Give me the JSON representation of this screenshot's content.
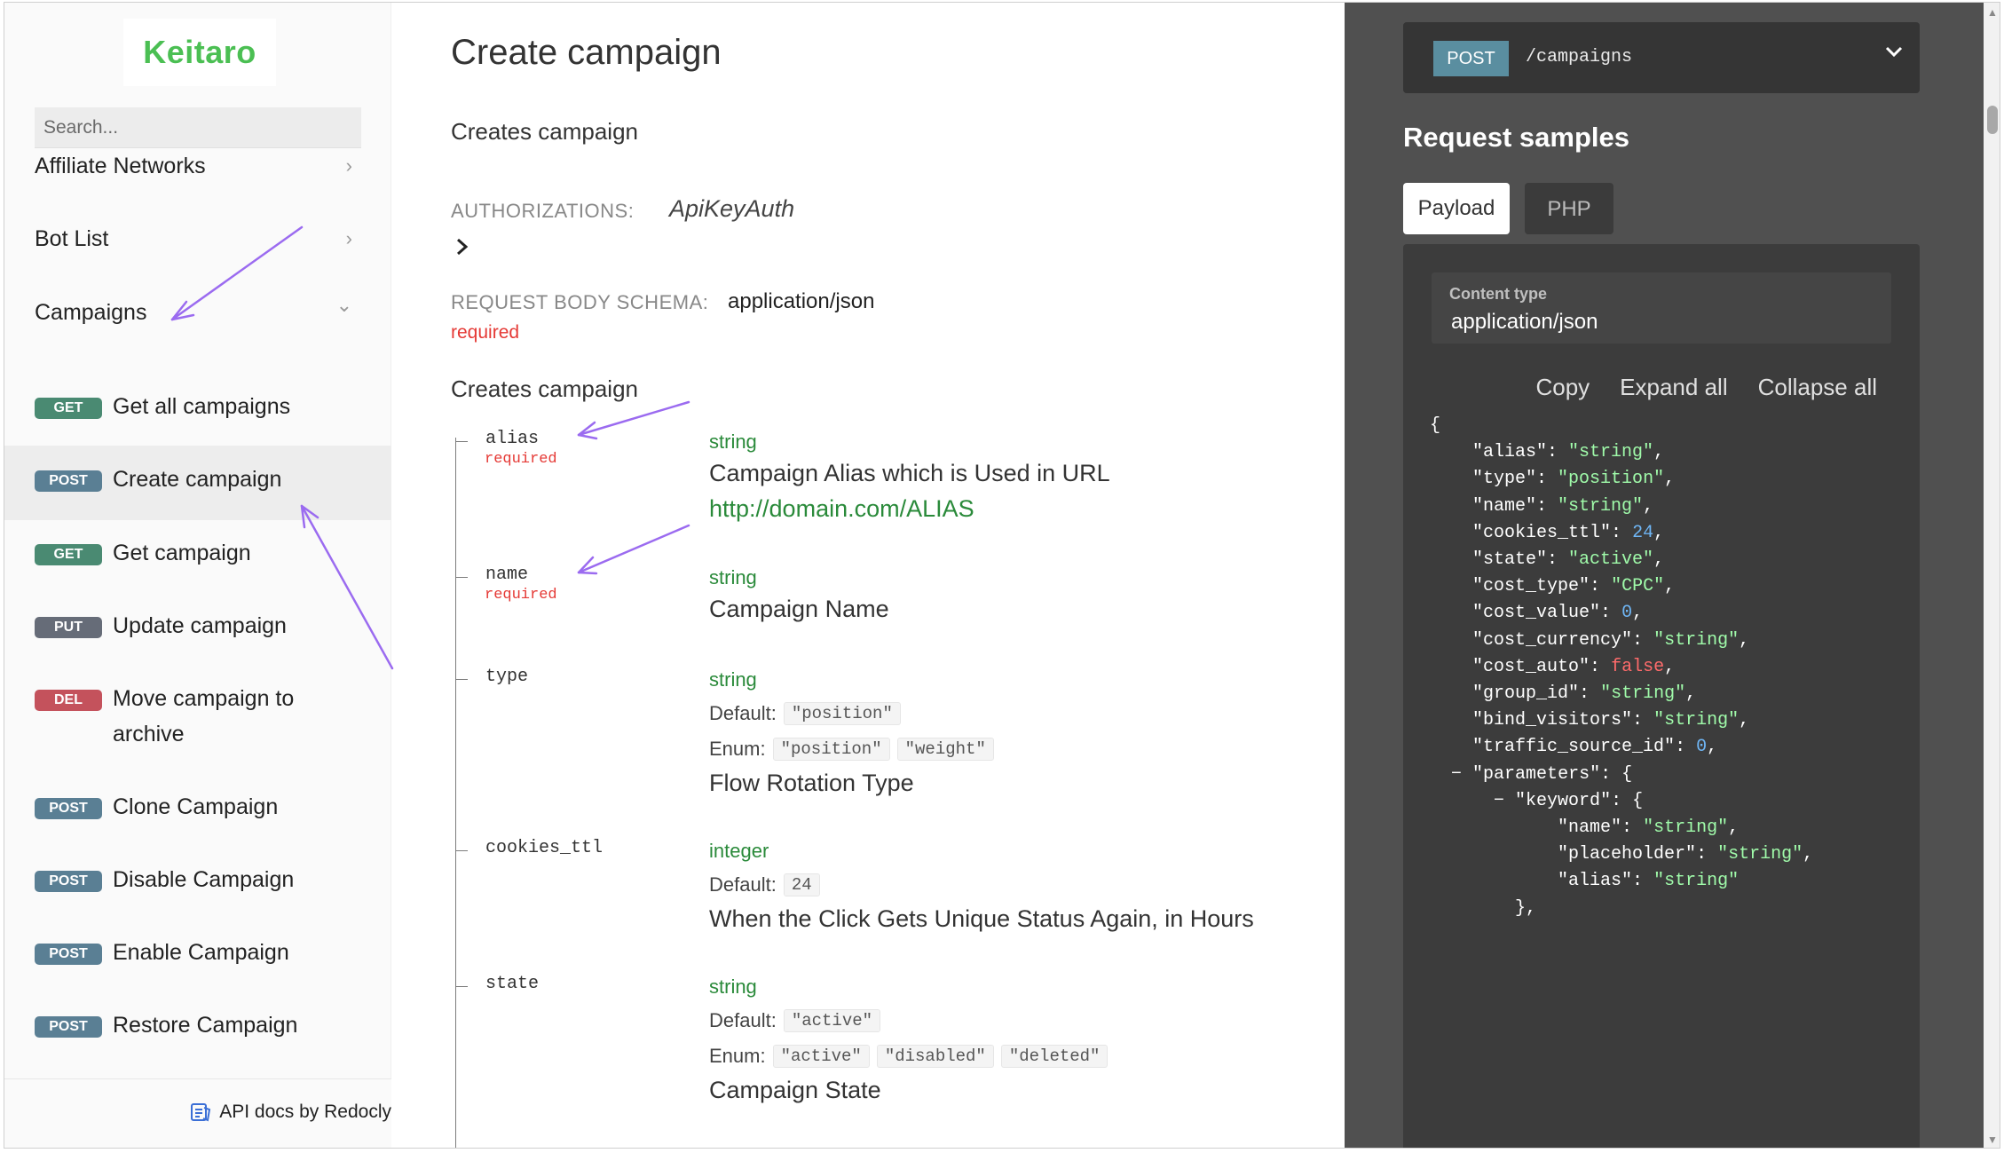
{
  "sidebar": {
    "logo": "Keitaro",
    "search_placeholder": "Search...",
    "groups": [
      {
        "label": "Affiliate Networks",
        "chevron": "›"
      },
      {
        "label": "Bot List",
        "chevron": "›"
      },
      {
        "label": "Campaigns",
        "chevron": "⌄"
      }
    ],
    "operations": [
      {
        "method": "GET",
        "label": "Get all campaigns"
      },
      {
        "method": "POST",
        "label": "Create campaign"
      },
      {
        "method": "GET",
        "label": "Get campaign"
      },
      {
        "method": "PUT",
        "label": "Update campaign"
      },
      {
        "method": "DEL",
        "label": "Move campaign to archive"
      },
      {
        "method": "POST",
        "label": "Clone Campaign"
      },
      {
        "method": "POST",
        "label": "Disable Campaign"
      },
      {
        "method": "POST",
        "label": "Enable Campaign"
      },
      {
        "method": "POST",
        "label": "Restore Campaign"
      }
    ],
    "footer": "API docs by Redocly"
  },
  "main": {
    "title": "Create campaign",
    "description": "Creates campaign",
    "auth_label": "AUTHORIZATIONS:",
    "auth_value": "ApiKeyAuth",
    "schema_label": "REQUEST BODY SCHEMA:",
    "schema_value": "application/json",
    "required_text": "required",
    "body_heading": "Creates campaign",
    "props": [
      {
        "name": "alias",
        "required": "required",
        "type": "string",
        "description": "Campaign Alias which is Used in URL",
        "link": "http://domain.com/ALIAS"
      },
      {
        "name": "name",
        "required": "required",
        "type": "string",
        "description": "Campaign Name"
      },
      {
        "name": "type",
        "type": "string",
        "default_label": "Default:",
        "default": "\"position\"",
        "enum_label": "Enum:",
        "enum": [
          "\"position\"",
          "\"weight\""
        ],
        "description": "Flow Rotation Type"
      },
      {
        "name": "cookies_ttl",
        "type": "integer",
        "default_label": "Default:",
        "default": "24",
        "description": "When the Click Gets Unique Status Again, in Hours"
      },
      {
        "name": "state",
        "type": "string",
        "default_label": "Default:",
        "default": "\"active\"",
        "enum_label": "Enum:",
        "enum": [
          "\"active\"",
          "\"disabled\"",
          "\"deleted\""
        ],
        "description": "Campaign State"
      }
    ]
  },
  "right": {
    "method": "POST",
    "path": "/campaigns",
    "samples_title": "Request samples",
    "tabs": [
      "Payload",
      "PHP"
    ],
    "content_type_label": "Content type",
    "content_type_value": "application/json",
    "toolbar": [
      "Copy",
      "Expand all",
      "Collapse all"
    ]
  },
  "colors": {
    "logo": "#4bbf53",
    "get": "#4a8a72",
    "post": "#5a7f94",
    "put": "#666c78",
    "del": "#c4525c",
    "type_green": "#2a8a3a",
    "required_red": "#e53935",
    "right_panel": "#505050",
    "annotation_arrow": "#9b6bf0"
  }
}
